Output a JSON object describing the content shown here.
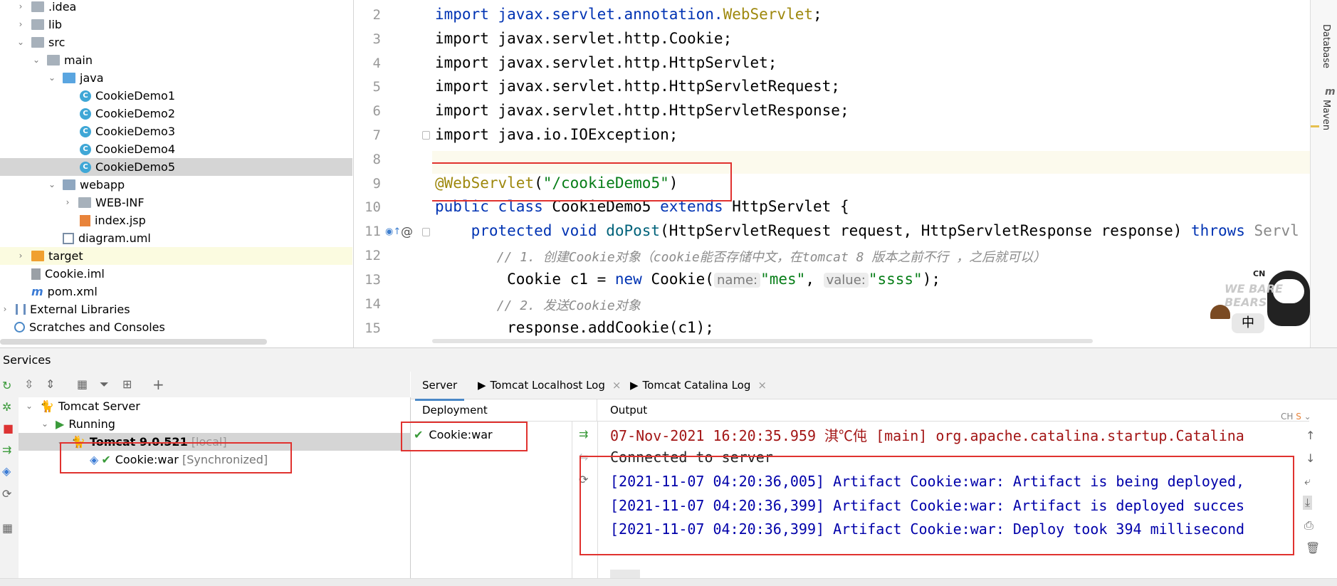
{
  "project_tree": {
    "items": [
      {
        "label": ".idea",
        "type": "folder",
        "chev": "›"
      },
      {
        "label": "lib",
        "type": "folder",
        "chev": "›"
      },
      {
        "label": "src",
        "type": "folder",
        "chev": "⌄"
      },
      {
        "label": "main",
        "type": "folder",
        "chev": "⌄"
      },
      {
        "label": "java",
        "type": "folder-blue",
        "chev": "⌄"
      },
      {
        "label": "CookieDemo1",
        "type": "class"
      },
      {
        "label": "CookieDemo2",
        "type": "class"
      },
      {
        "label": "CookieDemo3",
        "type": "class"
      },
      {
        "label": "CookieDemo4",
        "type": "class"
      },
      {
        "label": "CookieDemo5",
        "type": "class"
      },
      {
        "label": "webapp",
        "type": "folder-web",
        "chev": "⌄"
      },
      {
        "label": "WEB-INF",
        "type": "folder",
        "chev": "›"
      },
      {
        "label": "index.jsp",
        "type": "jsp"
      },
      {
        "label": "diagram.uml",
        "type": "uml"
      },
      {
        "label": "target",
        "type": "folder-orange",
        "chev": "›"
      },
      {
        "label": "Cookie.iml",
        "type": "file"
      },
      {
        "label": "pom.xml",
        "type": "maven"
      },
      {
        "label": "External Libraries",
        "type": "libs",
        "chev": "›"
      },
      {
        "label": "Scratches and Consoles",
        "type": "scratch"
      }
    ]
  },
  "editor": {
    "line_numbers": [
      "2",
      "3",
      "4",
      "5",
      "6",
      "7",
      "8",
      "9",
      "10",
      "11",
      "12",
      "13",
      "14",
      "15"
    ],
    "lines": {
      "l2a": "import javax.servlet.annotation.",
      "l2b": "WebServlet",
      "l2c": ";",
      "l3": "import javax.servlet.http.Cookie;",
      "l4": "import javax.servlet.http.HttpServlet;",
      "l5": "import javax.servlet.http.HttpServletRequest;",
      "l6": "import javax.servlet.http.HttpServletResponse;",
      "l7": "import java.io.IOException;",
      "l9a": "@WebServlet",
      "l9b": "(",
      "l9c": "\"/cookieDemo5\"",
      "l9d": ")",
      "l10a": "public class ",
      "l10b": "CookieDemo5 ",
      "l10c": "extends ",
      "l10d": "HttpServlet {",
      "l11a": "    protected void ",
      "l11b": "doPost",
      "l11c": "(HttpServletRequest request, HttpServletResponse response) ",
      "l11d": "throws ",
      "l11e": "Servl",
      "l12": "        // 1. 创建Cookie对象（cookie能否存储中文，在tomcat 8 版本之前不行 ，之后就可以）",
      "l13a": "        Cookie c1 = ",
      "l13b": "new ",
      "l13c": "Cookie(",
      "l13d": "name:",
      "l13e": "\"mes\"",
      "l13f": ", ",
      "l13g": "value:",
      "l13h": "\"ssss\"",
      "l13i": ");",
      "l14": "        // 2. 发送Cookie对象",
      "l15": "        response.addCookie(c1);"
    }
  },
  "right_strip": {
    "database": "Database",
    "maven": "Maven"
  },
  "services": {
    "title": "Services",
    "tree": {
      "server": "Tomcat Server",
      "running": "Running",
      "instance": "Tomcat 9.0.521",
      "instance_tag": "[local]",
      "artifact": "Cookie:war",
      "artifact_tag": "[Synchronized]"
    },
    "tabs": [
      "Server",
      "Tomcat Localhost Log",
      "Tomcat Catalina Log"
    ],
    "deployment_header": "Deployment",
    "output_header": "Output",
    "deployment_item": "Cookie:war",
    "output_lines": [
      "07-Nov-2021 16:20:35.959 淇℃伅 [main] org.apache.catalina.startup.Catalina",
      "Connected to server",
      "[2021-11-07 04:20:36,005] Artifact Cookie:war: Artifact is being deployed,",
      "[2021-11-07 04:20:36,399] Artifact Cookie:war: Artifact is deployed succes",
      "[2021-11-07 04:20:36,399] Artifact Cookie:war: Deploy took 394 millisecond"
    ]
  },
  "sticker": {
    "brand": "WE BARE BEARS",
    "channel": "CN",
    "lang": "中",
    "ime": "CH"
  },
  "colors": {
    "highlight_red": "#e0322f",
    "keyword": "#0033b3",
    "string": "#067d17"
  }
}
